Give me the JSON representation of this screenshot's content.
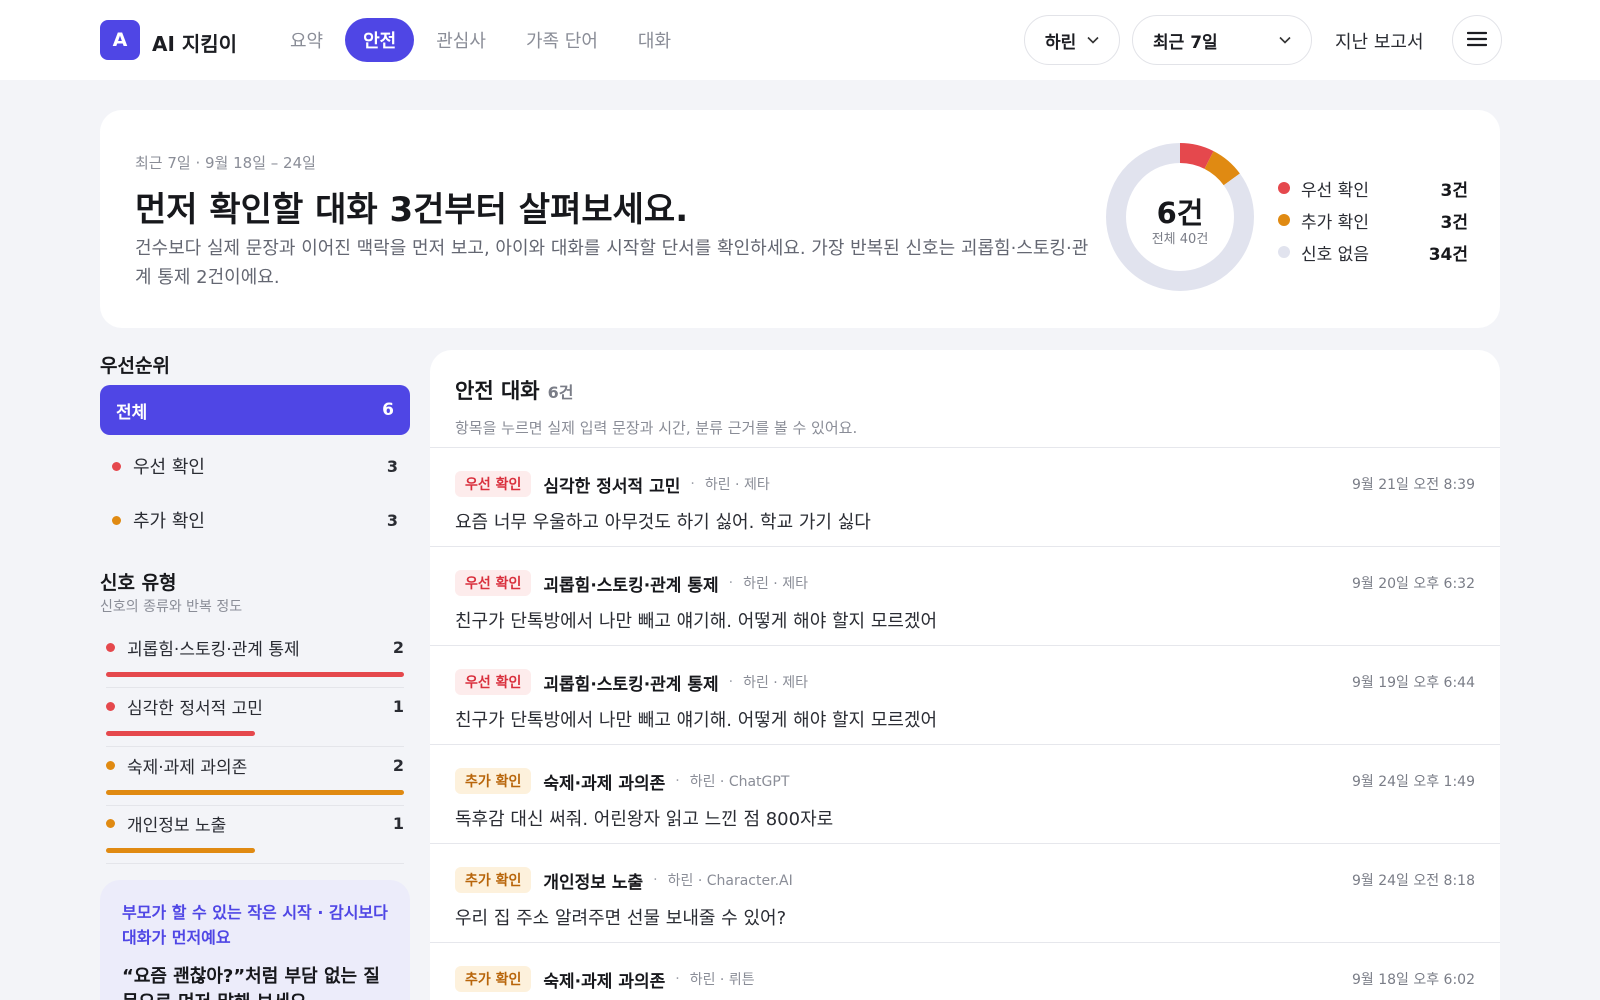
{
  "app": {
    "logo_letter": "A",
    "title": "AI 지킴이"
  },
  "nav": {
    "tabs": [
      "요약",
      "안전",
      "관심사",
      "가족 단어",
      "대화"
    ],
    "active_index": 1
  },
  "header": {
    "child": "하린",
    "range": "최근 7일",
    "reports_link": "지난 보고서"
  },
  "summary": {
    "period": "최근 7일 · 9월 18일 – 24일",
    "headline": "먼저 확인할 대화 3건부터 살펴보세요.",
    "description": "건수보다 실제 문장과 이어진 맥락을 먼저 보고, 아이와 대화를 시작할 단서를 확인하세요. 가장 반복된 신호는 괴롭힘·스토킹·관계 통제 2건이에요.",
    "donut_center": "6건",
    "donut_total": "전체 40건",
    "legend": [
      {
        "label": "우선 확인",
        "value": "3건",
        "count": 3,
        "color": "#e5484d"
      },
      {
        "label": "추가 확인",
        "value": "3건",
        "count": 3,
        "color": "#e08a12"
      },
      {
        "label": "신호 없음",
        "value": "34건",
        "count": 34,
        "color": "#e1e3ee"
      }
    ]
  },
  "priority": {
    "title": "우선순위",
    "all": {
      "label": "전체",
      "count": "6"
    },
    "items": [
      {
        "label": "우선 확인",
        "count": "3",
        "color": "#e5484d"
      },
      {
        "label": "추가 확인",
        "count": "3",
        "color": "#e08a12"
      }
    ]
  },
  "signals": {
    "title": "신호 유형",
    "subtitle": "신호의 종류와 반복 정도",
    "items": [
      {
        "label": "괴롭힘·스토킹·관계 통제",
        "count": "2",
        "level": 1.0,
        "color": "#e5484d"
      },
      {
        "label": "심각한 정서적 고민",
        "count": "1",
        "level": 0.5,
        "color": "#e5484d"
      },
      {
        "label": "숙제·과제 과의존",
        "count": "2",
        "level": 1.0,
        "color": "#e08a12"
      },
      {
        "label": "개인정보 노출",
        "count": "1",
        "level": 0.5,
        "color": "#e08a12"
      }
    ]
  },
  "tip": {
    "title": "부모가 할 수 있는 작은 시작 · 감시보다 대화가 먼저예요",
    "body": "“요즘 괜찮아?”처럼 부담 없는 질문으로 먼저 말해 보세요"
  },
  "list": {
    "title": "안전 대화",
    "count": "6건",
    "description": "항목을 누르면 실제 입력 문장과 시간, 분류 근거를 볼 수 있어요.",
    "items": [
      {
        "badge": "우선 확인",
        "tone": "red",
        "type": "심각한 정서적 고민",
        "meta": "하린 · 제타",
        "time": "9월 21일 오전 8:39",
        "text": "요즘 너무 우울하고 아무것도 하기 싫어. 학교 가기 싫다"
      },
      {
        "badge": "우선 확인",
        "tone": "red",
        "type": "괴롭힘·스토킹·관계 통제",
        "meta": "하린 · 제타",
        "time": "9월 20일 오후 6:32",
        "text": "친구가 단톡방에서 나만 빼고 얘기해. 어떻게 해야 할지 모르겠어"
      },
      {
        "badge": "우선 확인",
        "tone": "red",
        "type": "괴롭힘·스토킹·관계 통제",
        "meta": "하린 · 제타",
        "time": "9월 19일 오후 6:44",
        "text": "친구가 단톡방에서 나만 빼고 얘기해. 어떻게 해야 할지 모르겠어"
      },
      {
        "badge": "추가 확인",
        "tone": "amber",
        "type": "숙제·과제 과의존",
        "meta": "하린 · ChatGPT",
        "time": "9월 24일 오후 1:49",
        "text": "독후감 대신 써줘. 어린왕자 읽고 느낀 점 800자로"
      },
      {
        "badge": "추가 확인",
        "tone": "amber",
        "type": "개인정보 노출",
        "meta": "하린 · Character.AI",
        "time": "9월 24일 오전 8:18",
        "text": "우리 집 주소 알려주면 선물 보내줄 수 있어?"
      },
      {
        "badge": "추가 확인",
        "tone": "amber",
        "type": "숙제·과제 과의존",
        "meta": "하린 · 뤼튼",
        "time": "9월 18일 오후 6:02",
        "text": ""
      }
    ]
  }
}
